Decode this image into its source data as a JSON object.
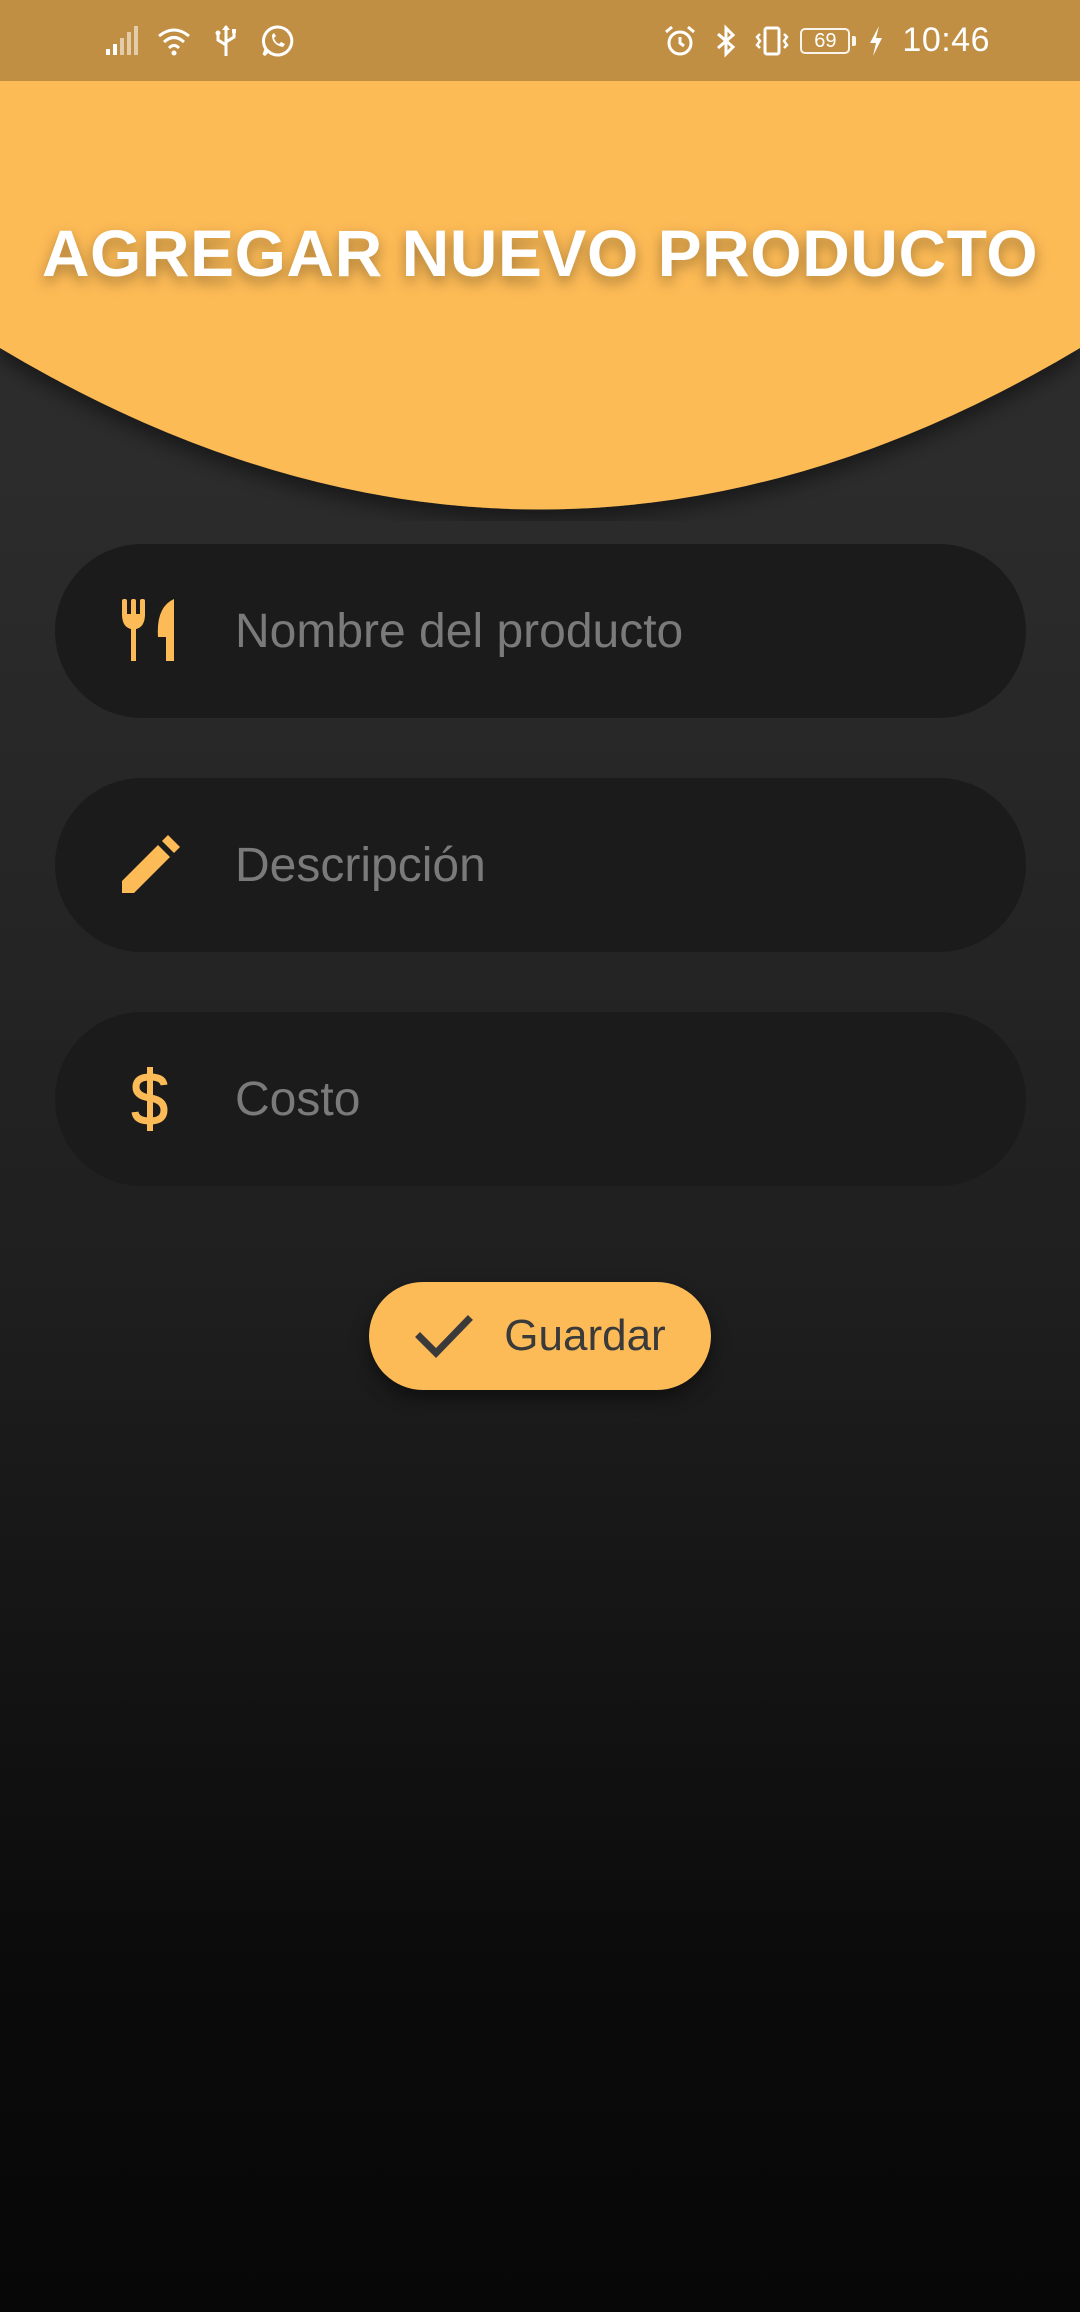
{
  "status_bar": {
    "battery_level": "69",
    "time": "10:46",
    "icons": [
      "signal-icon",
      "wifi-icon",
      "usb-icon",
      "whatsapp-icon",
      "alarm-icon",
      "bluetooth-icon",
      "vibrate-icon",
      "battery-icon",
      "charging-icon"
    ]
  },
  "header": {
    "title": "AGREGAR NUEVO PRODUCTO"
  },
  "form": {
    "fields": [
      {
        "icon": "utensils-icon",
        "value": "",
        "placeholder": "Nombre del producto"
      },
      {
        "icon": "pencil-icon",
        "value": "",
        "placeholder": "Descripción"
      },
      {
        "icon": "dollar-icon",
        "value": "",
        "placeholder": "Costo"
      }
    ],
    "save_label": "Guardar",
    "save_icon": "check-icon"
  },
  "colors": {
    "accent": "#fdbb57",
    "status_bar": "#c18f43",
    "field_background": "#1b1b1b",
    "placeholder": "#7a7a7a",
    "background_top": "#2f2f2f",
    "background_bottom": "#070707"
  }
}
